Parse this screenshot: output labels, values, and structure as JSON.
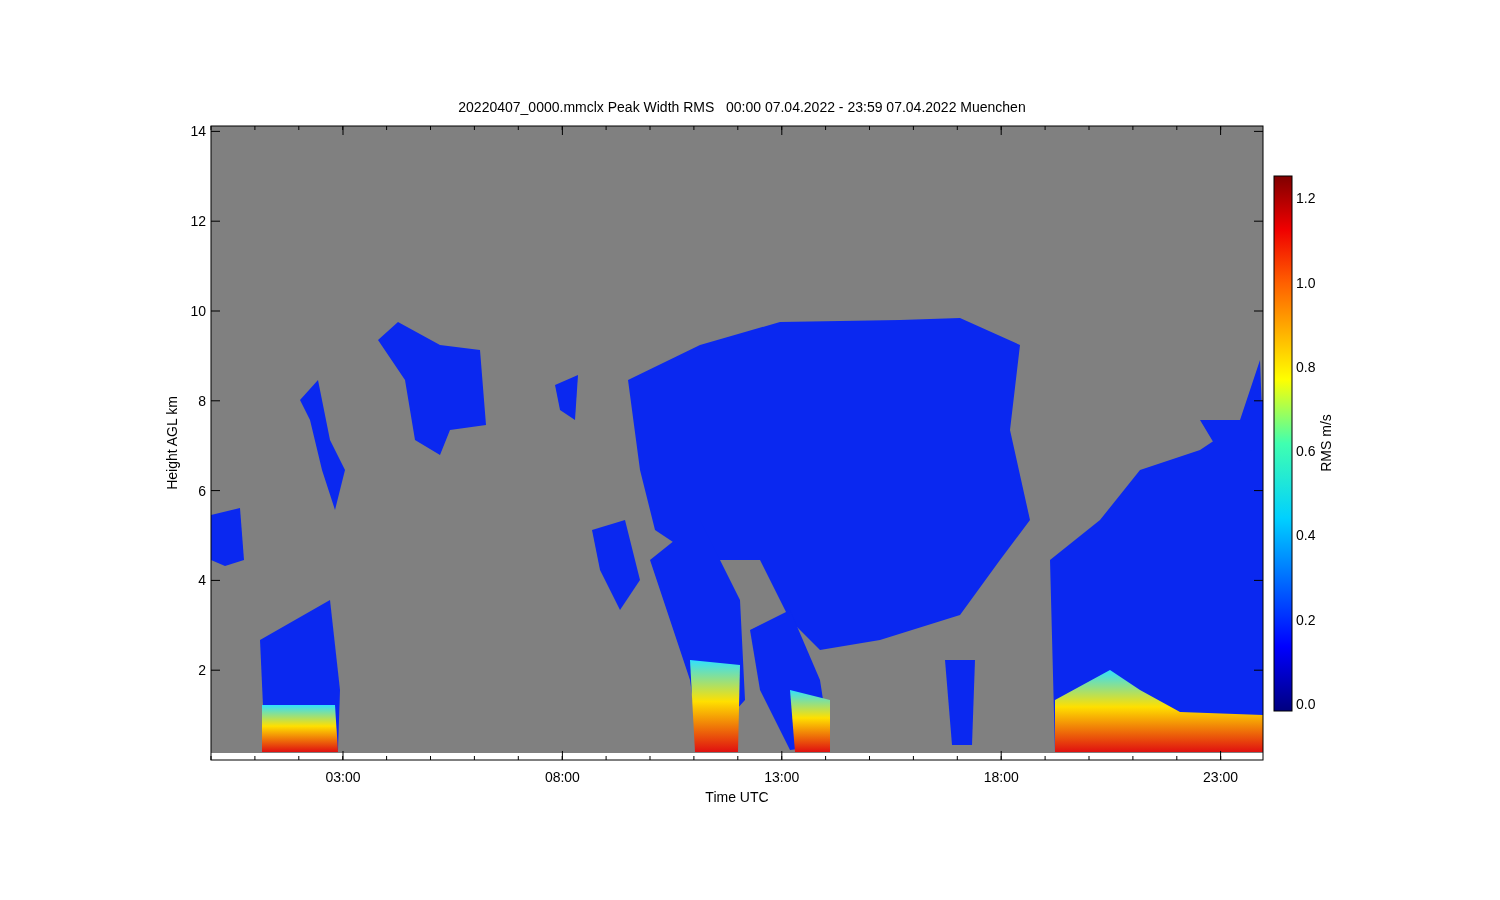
{
  "title": "20220407_0000.mmclx Peak Width RMS   00:00 07.04.2022 - 23:59 07.04.2022 Muenchen",
  "plot": {
    "xlabel": "Time UTC",
    "ylabel": "Height AGL km",
    "xticks": [
      "03:00",
      "08:00",
      "13:00",
      "18:00",
      "23:00"
    ],
    "yticks": [
      "14",
      "12",
      "10",
      "8",
      "6",
      "4",
      "2"
    ]
  },
  "colorbar": {
    "label": "RMS m/s",
    "ticks": [
      "1.2",
      "1.0",
      "0.8",
      "0.6",
      "0.4",
      "0.2",
      "0.0"
    ]
  }
}
